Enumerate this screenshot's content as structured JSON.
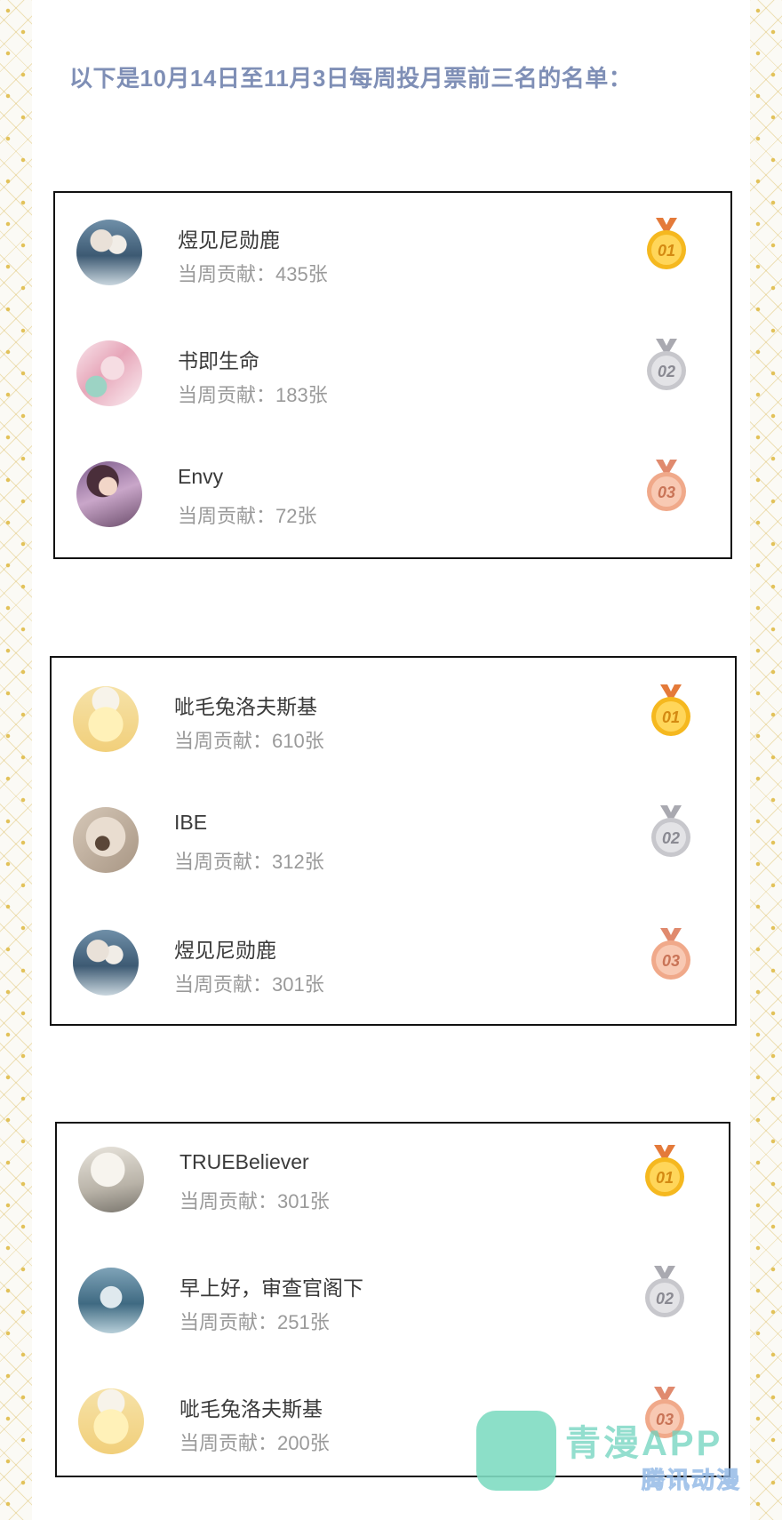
{
  "heading": "以下是10月14日至11月3日每周投月票前三名的名单：",
  "contrib_prefix": "当周贡献：",
  "weeks": [
    {
      "entries": [
        {
          "rank": "01",
          "medal": "gold-medal-icon",
          "name": "煜见尼勋鹿",
          "contribution": "当周贡献：435张",
          "avatar": "couple-avatar"
        },
        {
          "rank": "02",
          "medal": "silver-medal-icon",
          "name": "书即生命",
          "contribution": "当周贡献：183张",
          "avatar": "pink-anime-avatar"
        },
        {
          "rank": "03",
          "medal": "bronze-medal-icon",
          "name": "Envy",
          "contribution": "当周贡献：72张",
          "avatar": "anime-girl-avatar"
        }
      ]
    },
    {
      "entries": [
        {
          "rank": "01",
          "medal": "gold-medal-icon",
          "name": "呲毛兔洛夫斯基",
          "contribution": "当周贡献：610张",
          "avatar": "cartoon-cat-avatar"
        },
        {
          "rank": "02",
          "medal": "silver-medal-icon",
          "name": "IBE",
          "contribution": "当周贡献：312张",
          "avatar": "blurry-photo-avatar"
        },
        {
          "rank": "03",
          "medal": "bronze-medal-icon",
          "name": "煜见尼勋鹿",
          "contribution": "当周贡献：301张",
          "avatar": "couple-avatar"
        }
      ]
    },
    {
      "entries": [
        {
          "rank": "01",
          "medal": "gold-medal-icon",
          "name": "TRUEBeliever",
          "contribution": "当周贡献：301张",
          "avatar": "white-haired-character-avatar"
        },
        {
          "rank": "02",
          "medal": "silver-medal-icon",
          "name": "早上好，审查官阁下",
          "contribution": "当周贡献：251张",
          "avatar": "blue-landscape-avatar"
        },
        {
          "rank": "03",
          "medal": "bronze-medal-icon",
          "name": "呲毛兔洛夫斯基",
          "contribution": "当周贡献：200张",
          "avatar": "cartoon-cat-avatar"
        }
      ]
    }
  ],
  "watermark": {
    "title": "青漫APP",
    "subtitle": "腾讯动漫"
  },
  "colors": {
    "heading": "#7f8fb6",
    "gold": "#f5b81f",
    "silver": "#c7c7cc",
    "bronze": "#f0a98a",
    "border_gold": "#e2c25a",
    "card_border": "#111111"
  }
}
